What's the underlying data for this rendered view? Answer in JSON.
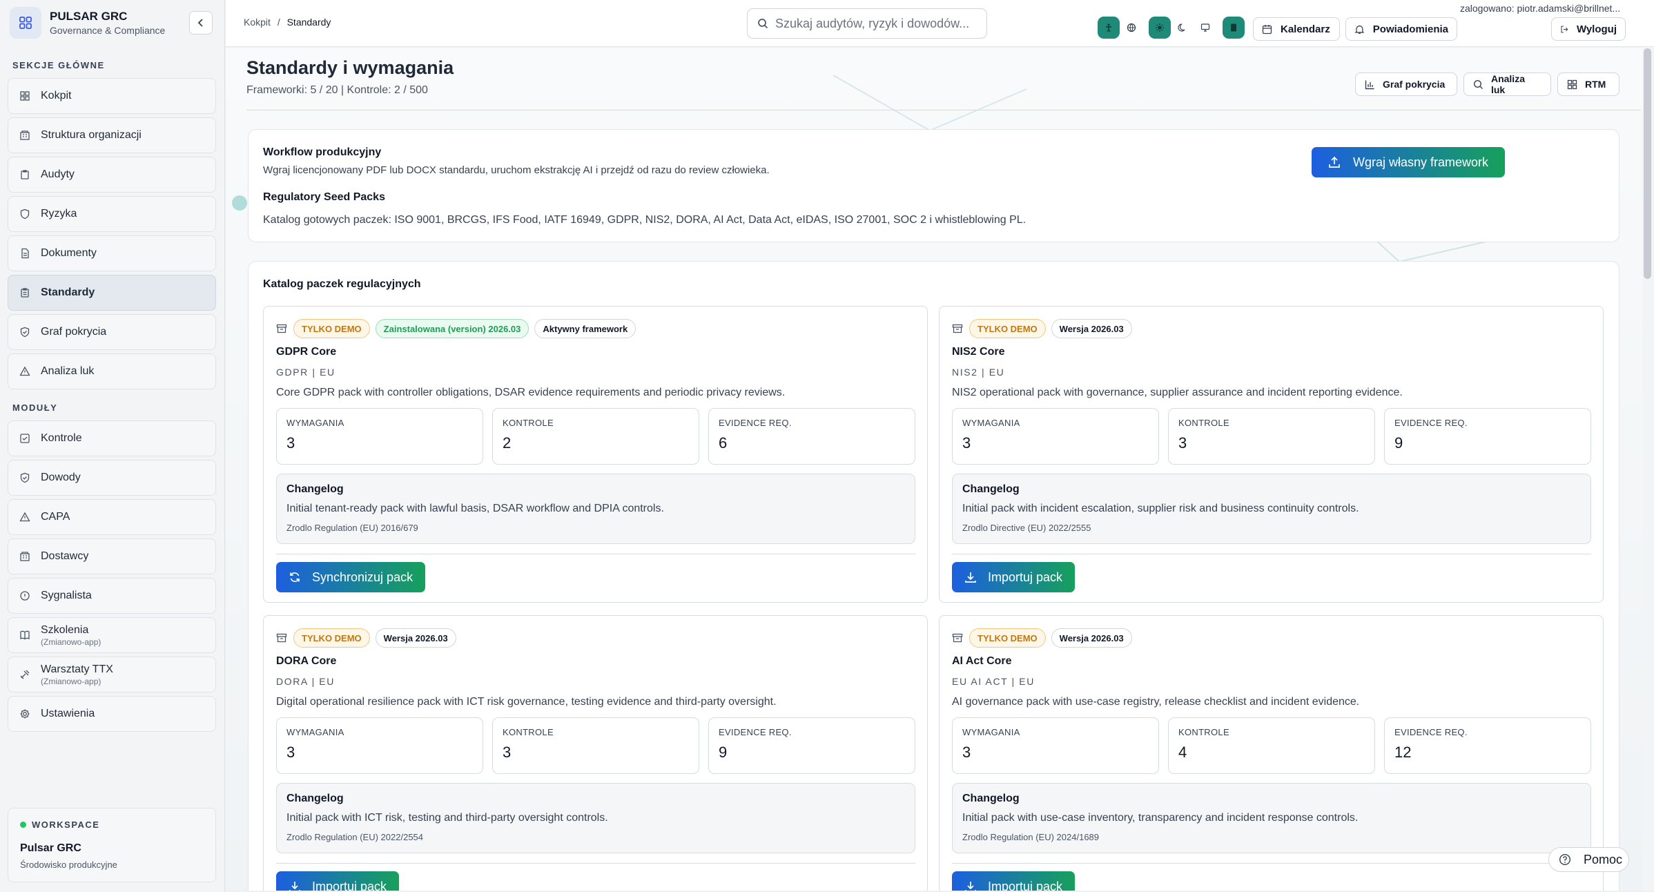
{
  "app": {
    "name": "PULSAR GRC",
    "subtitle": "Governance & Compliance"
  },
  "sidebar": {
    "main_section": "SEKCJE GŁÓWNE",
    "main_items": [
      {
        "label": "Kokpit",
        "icon": "grid-icon"
      },
      {
        "label": "Struktura organizacji",
        "icon": "building-icon"
      },
      {
        "label": "Audyty",
        "icon": "clipboard-icon"
      },
      {
        "label": "Ryzyka",
        "icon": "shield-icon"
      },
      {
        "label": "Dokumenty",
        "icon": "document-icon"
      },
      {
        "label": "Standardy",
        "icon": "clipboard-list-icon",
        "active": true
      },
      {
        "label": "Graf pokrycia",
        "icon": "shield-check-icon"
      },
      {
        "label": "Analiza luk",
        "icon": "warning-icon"
      }
    ],
    "modules_section": "MODUŁY",
    "module_items": [
      {
        "label": "Kontrole",
        "icon": "check-square-icon"
      },
      {
        "label": "Dowody",
        "icon": "shield-check-icon"
      },
      {
        "label": "CAPA",
        "icon": "warning-icon"
      },
      {
        "label": "Dostawcy",
        "icon": "building-icon"
      },
      {
        "label": "Sygnalista",
        "icon": "info-circle-icon"
      },
      {
        "label": "Szkolenia",
        "sub": "(Zmianowo-app)",
        "icon": "book-icon"
      },
      {
        "label": "Warsztaty TTX",
        "sub": "(Zmianowo-app)",
        "icon": "tools-icon"
      },
      {
        "label": "Ustawienia",
        "icon": "gear-icon"
      }
    ],
    "workspace": {
      "label": "WORKSPACE",
      "name": "Pulsar GRC",
      "env": "Środowisko produkcyjne"
    }
  },
  "topbar": {
    "breadcrumb_root": "Kokpit",
    "breadcrumb_sep": "/",
    "breadcrumb_current": "Standardy",
    "search_placeholder": "Szukaj audytów, ryzyk i dowodów...",
    "calendar_label": "Kalendarz",
    "notifications_label": "Powiadomienia",
    "logout_label": "Wyloguj",
    "user": "zalogowano: piotr.adamski@brillnet..."
  },
  "page": {
    "title": "Standardy i wymagania",
    "meta": "Frameworki: 5 / 20 | Kontrole: 2 / 500",
    "btn_graph": "Graf pokrycia",
    "btn_gap": "Analiza luk",
    "btn_rtm": "RTM"
  },
  "workflow": {
    "title": "Workflow produkcyjny",
    "desc": "Wgraj licencjonowany PDF lub DOCX standardu, uruchom ekstrakcję AI i przejdź od razu do review człowieka.",
    "seed_title": "Regulatory Seed Packs",
    "seed_desc": "Katalog gotowych paczek: ISO 9001, BRCGS, IFS Food, IATF 16949, GDPR, NIS2, DORA, AI Act, Data Act, eIDAS, ISO 27001, SOC 2 i whistleblowing PL.",
    "upload_label": "Wgraj własny framework"
  },
  "catalog": {
    "title": "Katalog paczek regulacyjnych",
    "labels": {
      "requirements": "WYMAGANIA",
      "controls": "KONTROLE",
      "evidence": "EVIDENCE REQ.",
      "changelog": "Changelog"
    },
    "packs": [
      {
        "badges": [
          "TYLKO DEMO",
          "Zainstalowana (version) 2026.03",
          "Aktywny framework"
        ],
        "name": "GDPR Core",
        "code": "GDPR | EU",
        "desc": "Core GDPR pack with controller obligations, DSAR evidence requirements and periodic privacy reviews.",
        "requirements": "3",
        "controls": "2",
        "evidence": "6",
        "changelog": "Initial tenant-ready pack with lawful basis, DSAR workflow and DPIA controls.",
        "source": "Zrodlo Regulation (EU) 2016/679",
        "action": "Synchronizuj pack"
      },
      {
        "badges": [
          "TYLKO DEMO",
          "Wersja 2026.03"
        ],
        "name": "NIS2 Core",
        "code": "NIS2 | EU",
        "desc": "NIS2 operational pack with governance, supplier assurance and incident reporting evidence.",
        "requirements": "3",
        "controls": "3",
        "evidence": "9",
        "changelog": "Initial pack with incident escalation, supplier risk and business continuity controls.",
        "source": "Zrodlo Directive (EU) 2022/2555",
        "action": "Importuj pack"
      },
      {
        "badges": [
          "TYLKO DEMO",
          "Wersja 2026.03"
        ],
        "name": "DORA Core",
        "code": "DORA | EU",
        "desc": "Digital operational resilience pack with ICT risk governance, testing evidence and third-party oversight.",
        "requirements": "3",
        "controls": "3",
        "evidence": "9",
        "changelog": "Initial pack with ICT risk, testing and third-party oversight controls.",
        "source": "Zrodlo Regulation (EU) 2022/2554",
        "action": "Importuj pack"
      },
      {
        "badges": [
          "TYLKO DEMO",
          "Wersja 2026.03"
        ],
        "name": "AI Act Core",
        "code": "EU AI ACT | EU",
        "desc": "AI governance pack with use-case registry, release checklist and incident evidence.",
        "requirements": "3",
        "controls": "4",
        "evidence": "12",
        "changelog": "Initial pack with use-case inventory, transparency and incident response controls.",
        "source": "Zrodlo Regulation (EU) 2024/1689",
        "action": "Importuj pack"
      }
    ]
  },
  "help_label": "Pomoc"
}
